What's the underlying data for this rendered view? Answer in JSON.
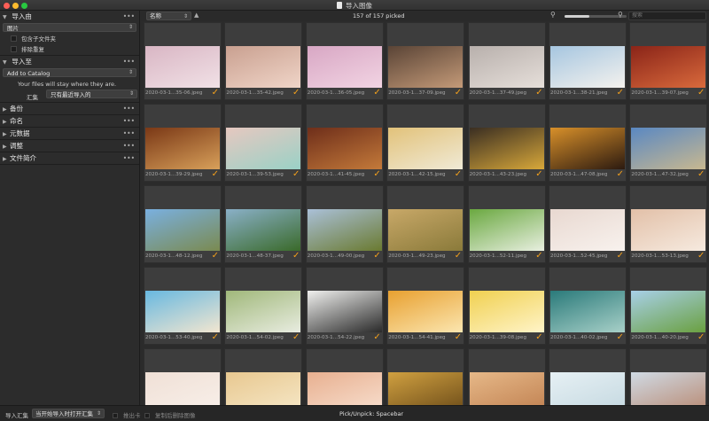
{
  "window": {
    "title": "导入图像"
  },
  "sidebar": {
    "import_from": {
      "title": "导入由",
      "source": "图片",
      "include_subfolders": "包含子文件夹",
      "exclude_duplicates": "排除重复"
    },
    "import_to": {
      "title": "导入至",
      "destination": "Add to Catalog",
      "note": "Your files will stay where they are.",
      "album_label": "汇集",
      "album_value": "只有最近导入的"
    },
    "sections": [
      {
        "title": "备份"
      },
      {
        "title": "命名"
      },
      {
        "title": "元数据"
      },
      {
        "title": "调整"
      },
      {
        "title": "文件简介"
      }
    ],
    "more_icon": "•••"
  },
  "toolbar": {
    "sort_label": "名称",
    "picked_count": "157 of 157 picked",
    "search_placeholder": "搜索",
    "zoom_level": 0.4
  },
  "bottombar": {
    "import_album_label": "导入汇集",
    "import_album_value": "当开始导入时打开汇集",
    "eject_label": "推出卡",
    "delete_after_copy_label": "复制后删除图像",
    "hint": "Pick/Unpick: Spacebar"
  },
  "thumbnails": [
    {
      "name": "2020-03-1...35-06.jpeg",
      "colors": [
        "#d9b6c4",
        "#f1e1e6"
      ],
      "picked": true
    },
    {
      "name": "2020-03-1...35-42.jpeg",
      "colors": [
        "#c9a090",
        "#f0d5c8"
      ],
      "picked": true
    },
    {
      "name": "2020-03-1...36-05.jpeg",
      "colors": [
        "#d8a7c4",
        "#f2d4e3"
      ],
      "picked": true
    },
    {
      "name": "2020-03-1...37-09.jpeg",
      "colors": [
        "#5a4436",
        "#c49a78"
      ],
      "picked": true
    },
    {
      "name": "2020-03-1...37-49.jpeg",
      "colors": [
        "#b8b0ac",
        "#e6dfda"
      ],
      "picked": true
    },
    {
      "name": "2020-03-1...38-21.jpeg",
      "colors": [
        "#a6c6e0",
        "#f4f2ee"
      ],
      "picked": true
    },
    {
      "name": "2020-03-1...39-07.jpeg",
      "colors": [
        "#8a2418",
        "#d96a3c"
      ],
      "picked": true
    },
    {
      "name": "2020-03-1...39-29.jpeg",
      "colors": [
        "#7a3816",
        "#d8a05a"
      ],
      "picked": true
    },
    {
      "name": "2020-03-1...39-53.jpeg",
      "colors": [
        "#e6c8c0",
        "#9ad1c6"
      ],
      "picked": true
    },
    {
      "name": "2020-03-1...41-45.jpeg",
      "colors": [
        "#6e2e1a",
        "#c47a3a"
      ],
      "picked": true
    },
    {
      "name": "2020-03-1...42-15.jpeg",
      "colors": [
        "#e2c27a",
        "#f0ead6"
      ],
      "picked": true
    },
    {
      "name": "2020-03-1...43-23.jpeg",
      "colors": [
        "#3a2e22",
        "#d8a83a"
      ],
      "picked": true
    },
    {
      "name": "2020-03-1...47-08.jpeg",
      "colors": [
        "#d8902a",
        "#2c1a10"
      ],
      "picked": true
    },
    {
      "name": "2020-03-1...47-32.jpeg",
      "colors": [
        "#5a88c2",
        "#c8b890"
      ],
      "picked": true
    },
    {
      "name": "2020-03-1...48-12.jpeg",
      "colors": [
        "#7ab0e0",
        "#7a8a50"
      ],
      "picked": true
    },
    {
      "name": "2020-03-1...48-37.jpeg",
      "colors": [
        "#8ab0c8",
        "#3a6a2a"
      ],
      "picked": true
    },
    {
      "name": "2020-03-1...49-00.jpeg",
      "colors": [
        "#aac0d8",
        "#6a7a30"
      ],
      "picked": true
    },
    {
      "name": "2020-03-1...49-23.jpeg",
      "colors": [
        "#c8a868",
        "#8a7a3a"
      ],
      "picked": true
    },
    {
      "name": "2020-03-1...52-11.jpeg",
      "colors": [
        "#6aa840",
        "#e8efe0"
      ],
      "picked": true
    },
    {
      "name": "2020-03-1...52-45.jpeg",
      "colors": [
        "#e8d8d0",
        "#f8f2ee"
      ],
      "picked": true
    },
    {
      "name": "2020-03-1...53-13.jpeg",
      "colors": [
        "#e2c0a8",
        "#f6eadf"
      ],
      "picked": true
    },
    {
      "name": "2020-03-1...53-40.jpeg",
      "colors": [
        "#68b8e0",
        "#f2e6d0"
      ],
      "picked": true
    },
    {
      "name": "2020-03-1...54-02.jpeg",
      "colors": [
        "#a0b87a",
        "#e8ece0"
      ],
      "picked": true
    },
    {
      "name": "2020-03-1...54-22.jpeg",
      "colors": [
        "#f0f0ee",
        "#2a2a2a"
      ],
      "picked": true
    },
    {
      "name": "2020-03-1...54-41.jpeg",
      "colors": [
        "#e8a030",
        "#fbe6b0"
      ],
      "picked": true
    },
    {
      "name": "2020-03-1...39-08.jpeg",
      "colors": [
        "#f0d050",
        "#fff4c8"
      ],
      "picked": true
    },
    {
      "name": "2020-03-1...40-02.jpeg",
      "colors": [
        "#2a7a7a",
        "#a8d0c8"
      ],
      "picked": true
    },
    {
      "name": "2020-03-1...40-20.jpeg",
      "colors": [
        "#a8d0e8",
        "#6aa040"
      ],
      "picked": true
    },
    {
      "name": "",
      "colors": [
        "#f0e0d6",
        "#f8f0ea"
      ],
      "picked": false
    },
    {
      "name": "",
      "colors": [
        "#e8c890",
        "#f6e8c8"
      ],
      "picked": false
    },
    {
      "name": "",
      "colors": [
        "#e8b090",
        "#f8e0d0"
      ],
      "picked": false
    },
    {
      "name": "",
      "colors": [
        "#d0a040",
        "#6a4a18"
      ],
      "picked": false
    },
    {
      "name": "",
      "colors": [
        "#e6b888",
        "#c08050"
      ],
      "picked": false
    },
    {
      "name": "",
      "colors": [
        "#e6f0f4",
        "#c4d8e0"
      ],
      "picked": false
    },
    {
      "name": "",
      "colors": [
        "#d0dae4",
        "#b88870"
      ],
      "picked": false
    }
  ]
}
